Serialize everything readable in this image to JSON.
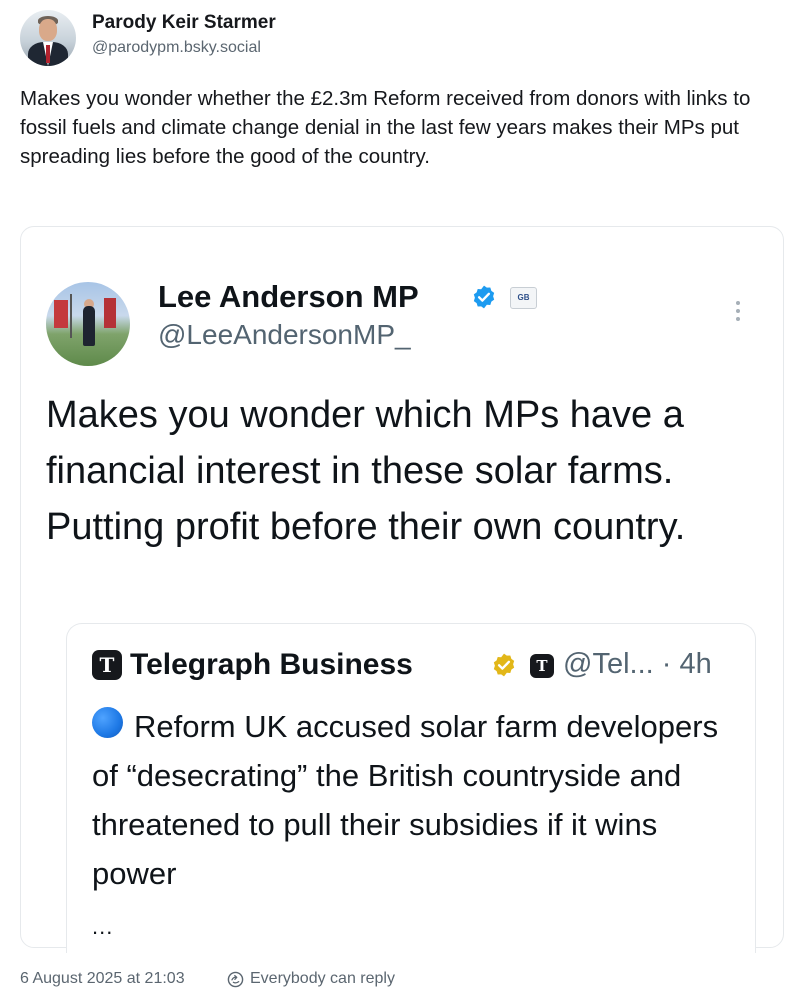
{
  "post": {
    "author_name": "Parody Keir Starmer",
    "author_handle": "@parodypm.bsky.social",
    "text": "Makes you wonder whether the £2.3m Reform received from donors with links to fossil fuels and climate change denial in the last few years makes their MPs put spreading lies before the good of the country.",
    "date": "6 August 2025 at 21:03",
    "reply_setting": "Everybody can reply"
  },
  "embed": {
    "author_name": "Lee Anderson MP",
    "author_handle": "@LeeAndersonMP_",
    "affiliate_badge": "GB",
    "text": "Makes you wonder which MPs have a financial interest in these solar farms. Putting profit before their own country.",
    "quote": {
      "author_name": "Telegraph Business",
      "meta": "@Tel... · 4h",
      "text": "Reform UK accused solar farm developers of “desecrating” the British countryside and threatened to pull their subsidies if it wins power",
      "ellipsis": "..."
    }
  },
  "colors": {
    "verified_blue": "#1d9bf0",
    "verified_gold": "#e2b719",
    "muted_text": "#536471"
  }
}
